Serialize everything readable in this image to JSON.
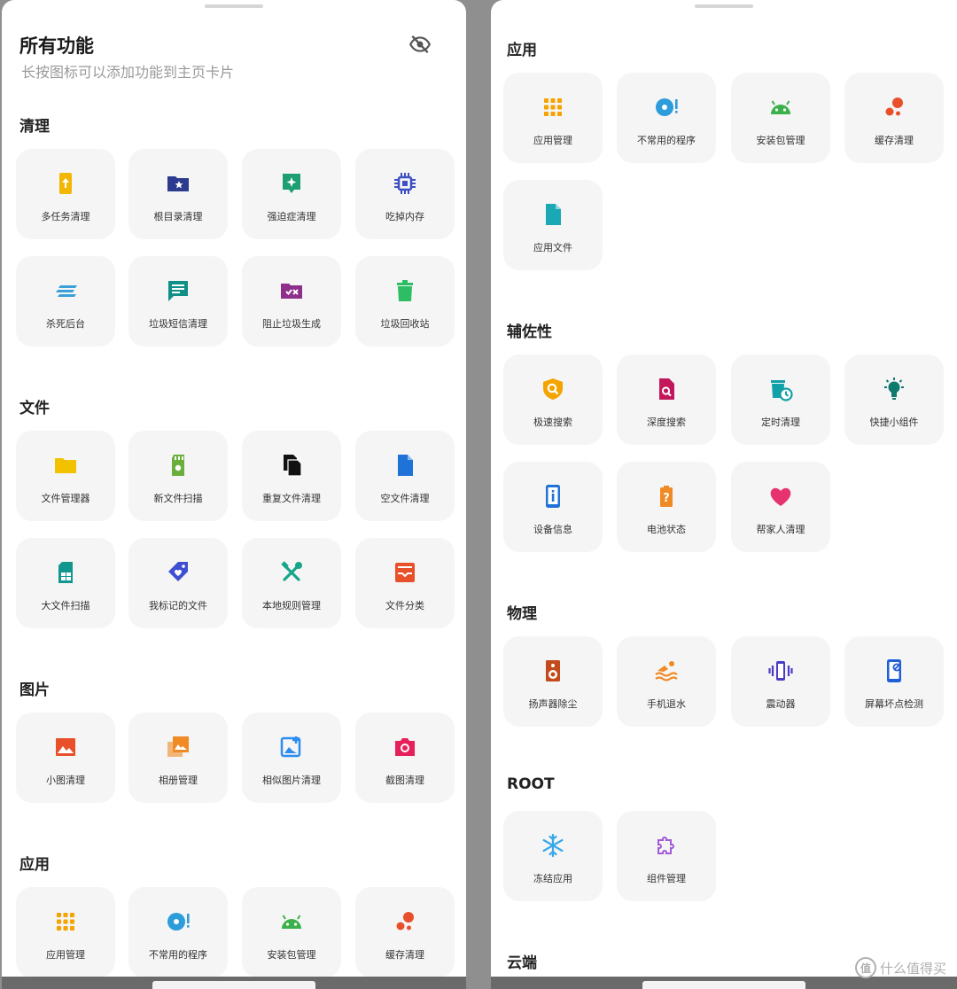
{
  "left": {
    "title": "所有功能",
    "subtitle": "长按图标可以添加功能到主页卡片",
    "toggle_icon": "eye-off-icon",
    "sections": [
      {
        "title": "清理",
        "items": [
          {
            "label": "多任务清理",
            "icon": "phone-upload-icon",
            "color": "#f2b705"
          },
          {
            "label": "根目录清理",
            "icon": "folder-star-icon",
            "color": "#2c3a8f"
          },
          {
            "label": "强迫症清理",
            "icon": "sparkle-bubble-icon",
            "color": "#1e9e73"
          },
          {
            "label": "吃掉内存",
            "icon": "chip-icon",
            "color": "#3d4fc4"
          },
          {
            "label": "杀死后台",
            "icon": "speed-lines-icon",
            "color": "#3aa0d8"
          },
          {
            "label": "垃圾短信清理",
            "icon": "message-icon",
            "color": "#0f8f86"
          },
          {
            "label": "阻止垃圾生成",
            "icon": "folder-block-icon",
            "color": "#8f2f8c"
          },
          {
            "label": "垃圾回收站",
            "icon": "trash-icon",
            "color": "#2dbe63"
          }
        ]
      },
      {
        "title": "文件",
        "items": [
          {
            "label": "文件管理器",
            "icon": "folder-icon",
            "color": "#f2c200"
          },
          {
            "label": "新文件扫描",
            "icon": "sd-card-icon",
            "color": "#6aae3c"
          },
          {
            "label": "重复文件清理",
            "icon": "copy-file-icon",
            "color": "#111111"
          },
          {
            "label": "空文件清理",
            "icon": "file-icon",
            "color": "#1f73d8"
          },
          {
            "label": "大文件扫描",
            "icon": "sim-card-icon",
            "color": "#12978f"
          },
          {
            "label": "我标记的文件",
            "icon": "tag-heart-icon",
            "color": "#3f4fd1"
          },
          {
            "label": "本地规则管理",
            "icon": "tools-icon",
            "color": "#17a589"
          },
          {
            "label": "文件分类",
            "icon": "inbox-icon",
            "color": "#e8502a"
          }
        ]
      },
      {
        "title": "图片",
        "items": [
          {
            "label": "小图清理",
            "icon": "image-icon",
            "color": "#e8502a"
          },
          {
            "label": "相册管理",
            "icon": "gallery-icon",
            "color": "#f08a24"
          },
          {
            "label": "相似图片清理",
            "icon": "image-plus-icon",
            "color": "#2d8cf0"
          },
          {
            "label": "截图清理",
            "icon": "camera-icon",
            "color": "#e6205a"
          }
        ]
      },
      {
        "title": "应用",
        "items": [
          {
            "label": "应用管理",
            "icon": "grid-icon",
            "color": "#f5a300"
          },
          {
            "label": "不常用的程序",
            "icon": "disc-alert-icon",
            "color": "#2d9cdb"
          },
          {
            "label": "安装包管理",
            "icon": "android-icon",
            "color": "#3cb04a"
          },
          {
            "label": "缓存清理",
            "icon": "bubbles-icon",
            "color": "#e8502a"
          }
        ]
      }
    ]
  },
  "right": {
    "sections": [
      {
        "title": "应用",
        "items": [
          {
            "label": "应用管理",
            "icon": "grid-icon",
            "color": "#f5a300"
          },
          {
            "label": "不常用的程序",
            "icon": "disc-alert-icon",
            "color": "#2d9cdb"
          },
          {
            "label": "安装包管理",
            "icon": "android-icon",
            "color": "#3cb04a"
          },
          {
            "label": "缓存清理",
            "icon": "bubbles-icon",
            "color": "#e8502a"
          },
          {
            "label": "应用文件",
            "icon": "file-icon",
            "color": "#1aa8b5"
          }
        ]
      },
      {
        "title": "辅佐性",
        "items": [
          {
            "label": "极速搜索",
            "icon": "shield-search-icon",
            "color": "#f5a300"
          },
          {
            "label": "深度搜索",
            "icon": "file-search-icon",
            "color": "#c2185b"
          },
          {
            "label": "定时清理",
            "icon": "trash-clock-icon",
            "color": "#12a0a8"
          },
          {
            "label": "快捷小组件",
            "icon": "bulb-icon",
            "color": "#0f7a6e"
          },
          {
            "label": "设备信息",
            "icon": "phone-info-icon",
            "color": "#1f73d8"
          },
          {
            "label": "电池状态",
            "icon": "battery-alert-icon",
            "color": "#f08a24"
          },
          {
            "label": "帮家人清理",
            "icon": "heart-icon",
            "color": "#e6336f"
          }
        ]
      },
      {
        "title": "物理",
        "items": [
          {
            "label": "扬声器除尘",
            "icon": "speaker-icon",
            "color": "#c24a1b"
          },
          {
            "label": "手机退水",
            "icon": "swim-icon",
            "color": "#f08a24"
          },
          {
            "label": "震动器",
            "icon": "vibrate-icon",
            "color": "#4a3cc4"
          },
          {
            "label": "屏幕坏点检测",
            "icon": "phone-scan-icon",
            "color": "#1f5fd8"
          }
        ]
      },
      {
        "title": "ROOT",
        "items": [
          {
            "label": "冻结应用",
            "icon": "snowflake-icon",
            "color": "#3aa8e8"
          },
          {
            "label": "组件管理",
            "icon": "puzzle-icon",
            "color": "#a25ad8"
          }
        ]
      },
      {
        "title": "云端",
        "items": []
      }
    ]
  },
  "watermark": {
    "icon_text": "值",
    "text": "什么值得买"
  }
}
